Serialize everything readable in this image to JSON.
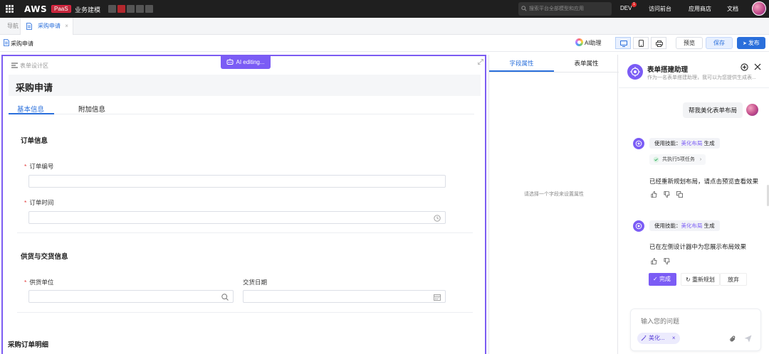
{
  "topbar": {
    "logo": "AWS",
    "badge": "PaaS",
    "app_name": "业务建模",
    "swatches": [
      "#555555",
      "#b3272d",
      "#555555",
      "#555555",
      "#555555"
    ],
    "search_placeholder": "搜索平台全部模型和应用",
    "env": "DEV",
    "env_badge": "1",
    "nav": [
      "访问前台",
      "应用商店",
      "文档"
    ]
  },
  "tabs": {
    "nav_label": "导航",
    "active_label": "采购申请"
  },
  "toolbar": {
    "page_name": "采购申请",
    "ai_assistant": "AI助理",
    "preview": "预览",
    "save": "保存",
    "publish": "发布"
  },
  "canvas": {
    "header": "表单设计区",
    "ai_editing": "AI editing...",
    "form_title": "采购申请",
    "tabs": [
      "基本信息",
      "附加信息"
    ],
    "sections": [
      {
        "title": "订单信息",
        "fields": [
          {
            "label": "订单编号",
            "required": "*"
          },
          {
            "label": "订单时间",
            "required": "*"
          }
        ]
      },
      {
        "title": "供货与交货信息",
        "fields": [
          {
            "label": "供货单位",
            "required": "*"
          },
          {
            "label": "交货日期"
          }
        ]
      }
    ],
    "bottom_title": "采购订单明细"
  },
  "props": {
    "tabs": [
      "字段属性",
      "表单属性"
    ],
    "empty_hint": "请选择一个字段来设置属性"
  },
  "assistant": {
    "title": "表单搭建助理",
    "subtitle": "作为一名表单搭建助理，我可以为您提供生成表...",
    "user_message": "帮我美化表单布局",
    "messages": [
      {
        "skill_prefix": "使用技能：",
        "skill_name": "美化布局",
        "skill_suffix": "生成",
        "task": "共执行5项任务",
        "text": "已经重新规划布局，请点击预览查看效果"
      },
      {
        "skill_prefix": "使用技能：",
        "skill_name": "美化布局",
        "skill_suffix": "生成",
        "text": "已在左侧设计器中为您展示布局效果"
      }
    ],
    "actions": {
      "done": "完成",
      "replan": "重新规划",
      "discard": "放弃"
    },
    "input_placeholder": "输入您的问题",
    "chip": "美化..."
  },
  "colors": {
    "accent_blue": "#2a6fdb",
    "ai_purple": "#7b5cf5",
    "required_red": "#e23d3d"
  }
}
